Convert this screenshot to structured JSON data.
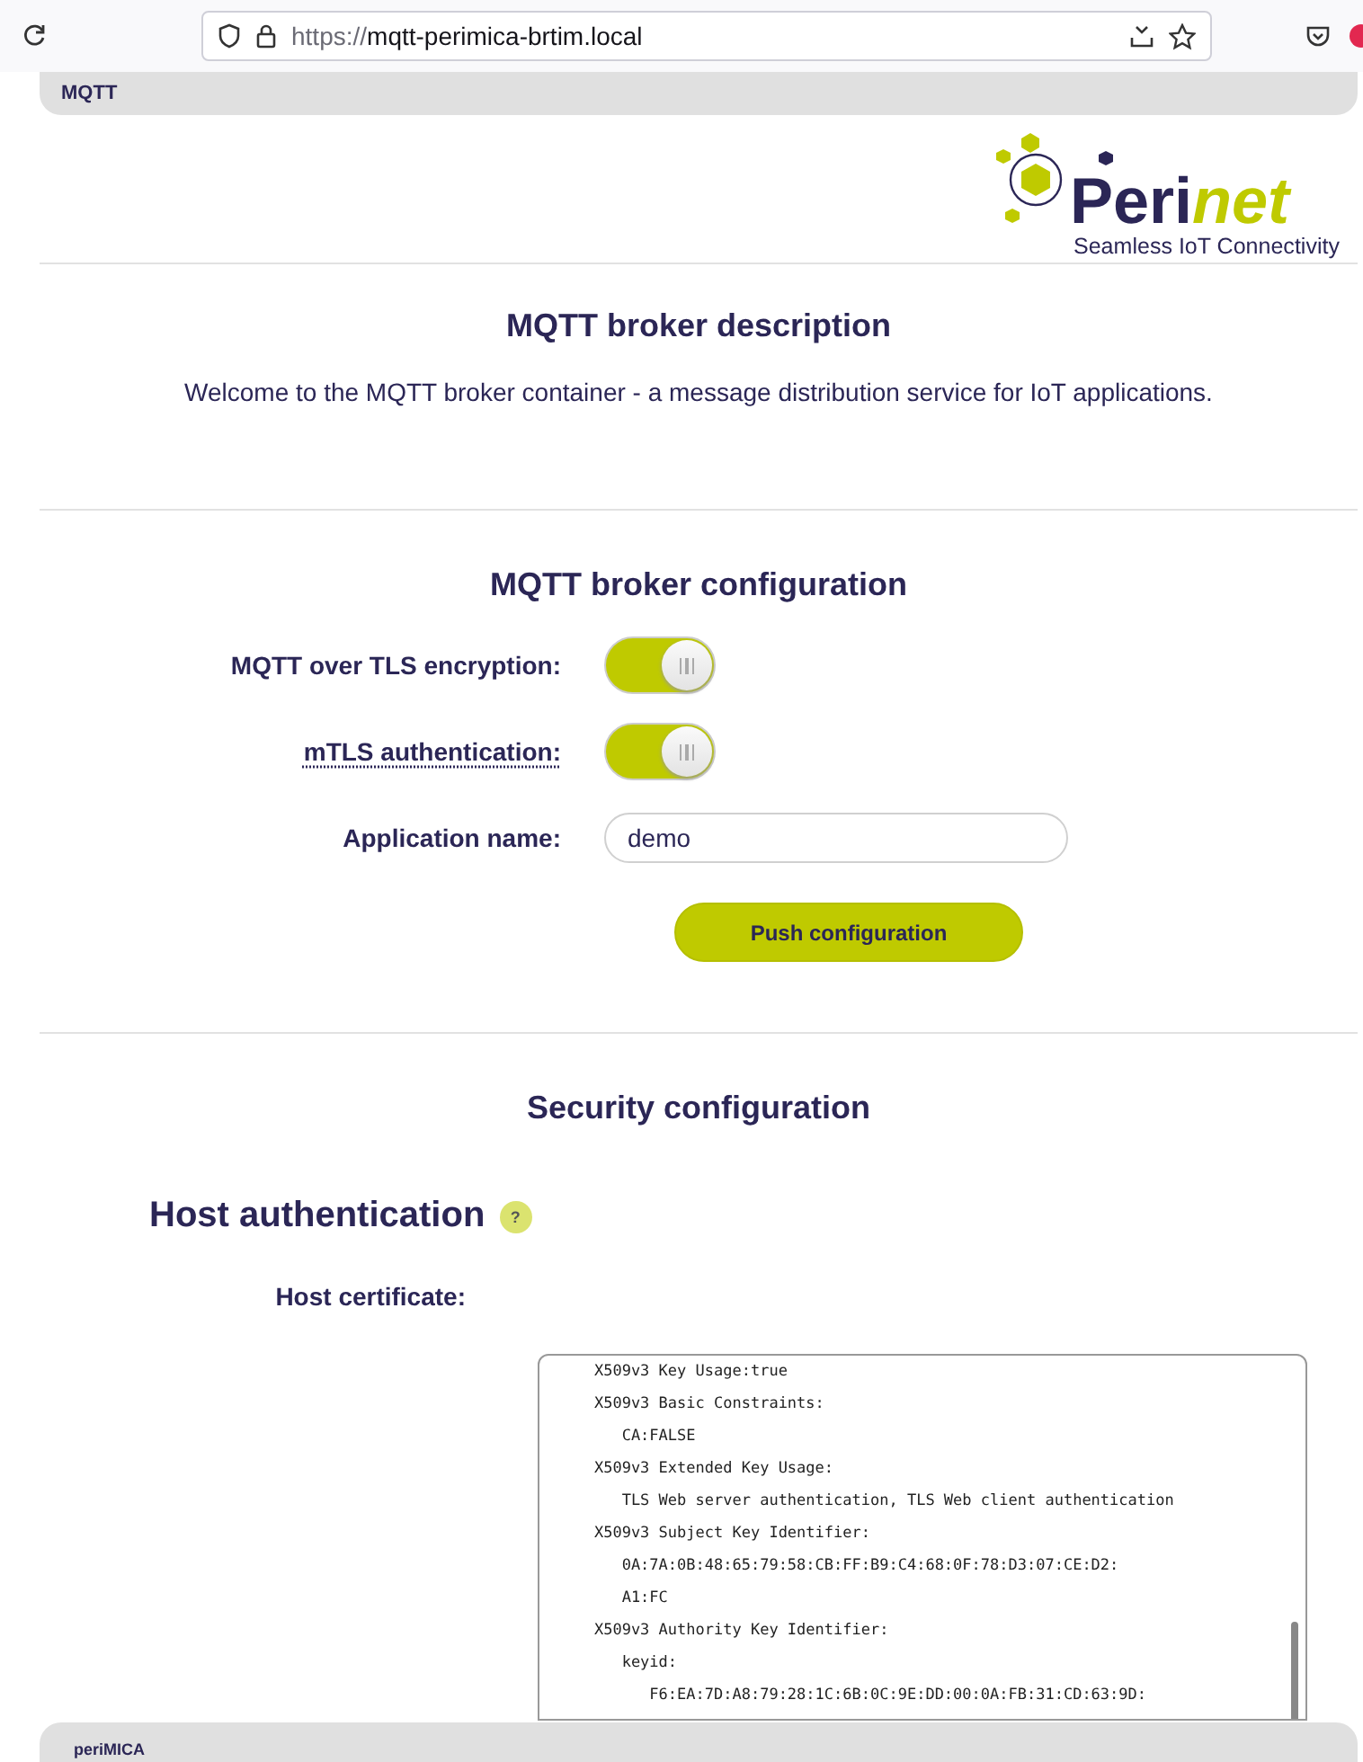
{
  "browser": {
    "url_scheme": "https://",
    "url_host": "mqtt-perimica-brtim.local"
  },
  "tabs": [
    {
      "label": "MQTT",
      "selected": true
    }
  ],
  "logo": {
    "name_dark": "Peri",
    "name_accent": "net",
    "tagline": "Seamless IoT Connectivity"
  },
  "description": {
    "title": "MQTT broker description",
    "text": "Welcome to the MQTT broker container - a message distribution service for IoT applications."
  },
  "configuration": {
    "title": "MQTT broker configuration",
    "rows": [
      {
        "kind": "toggle",
        "label": "MQTT over TLS encryption:",
        "on": true,
        "dotted": false
      },
      {
        "kind": "toggle",
        "label": "mTLS authentication:",
        "on": true,
        "dotted": true
      },
      {
        "kind": "text",
        "label": "Application name:",
        "value": "demo"
      }
    ],
    "button": "Push configuration"
  },
  "security": {
    "title": "Security configuration",
    "heading": "Host authentication",
    "help": "?",
    "cert_label": "Host certificate:",
    "cert_text": "    X509v3 Key Usage:true\n    X509v3 Basic Constraints:\n       CA:FALSE\n    X509v3 Extended Key Usage:\n       TLS Web server authentication, TLS Web client authentication\n    X509v3 Subject Key Identifier:\n       0A:7A:0B:48:65:79:58:CB:FF:B9:C4:68:0F:78:D3:07:CE:D2:\n       A1:FC\n    X509v3 Authority Key Identifier:\n       keyid:\n          F6:EA:7D:A8:79:28:1C:6B:0C:9E:DD:00:0A:FB:31:CD:63:9D:"
  },
  "footer": "periMICA"
}
